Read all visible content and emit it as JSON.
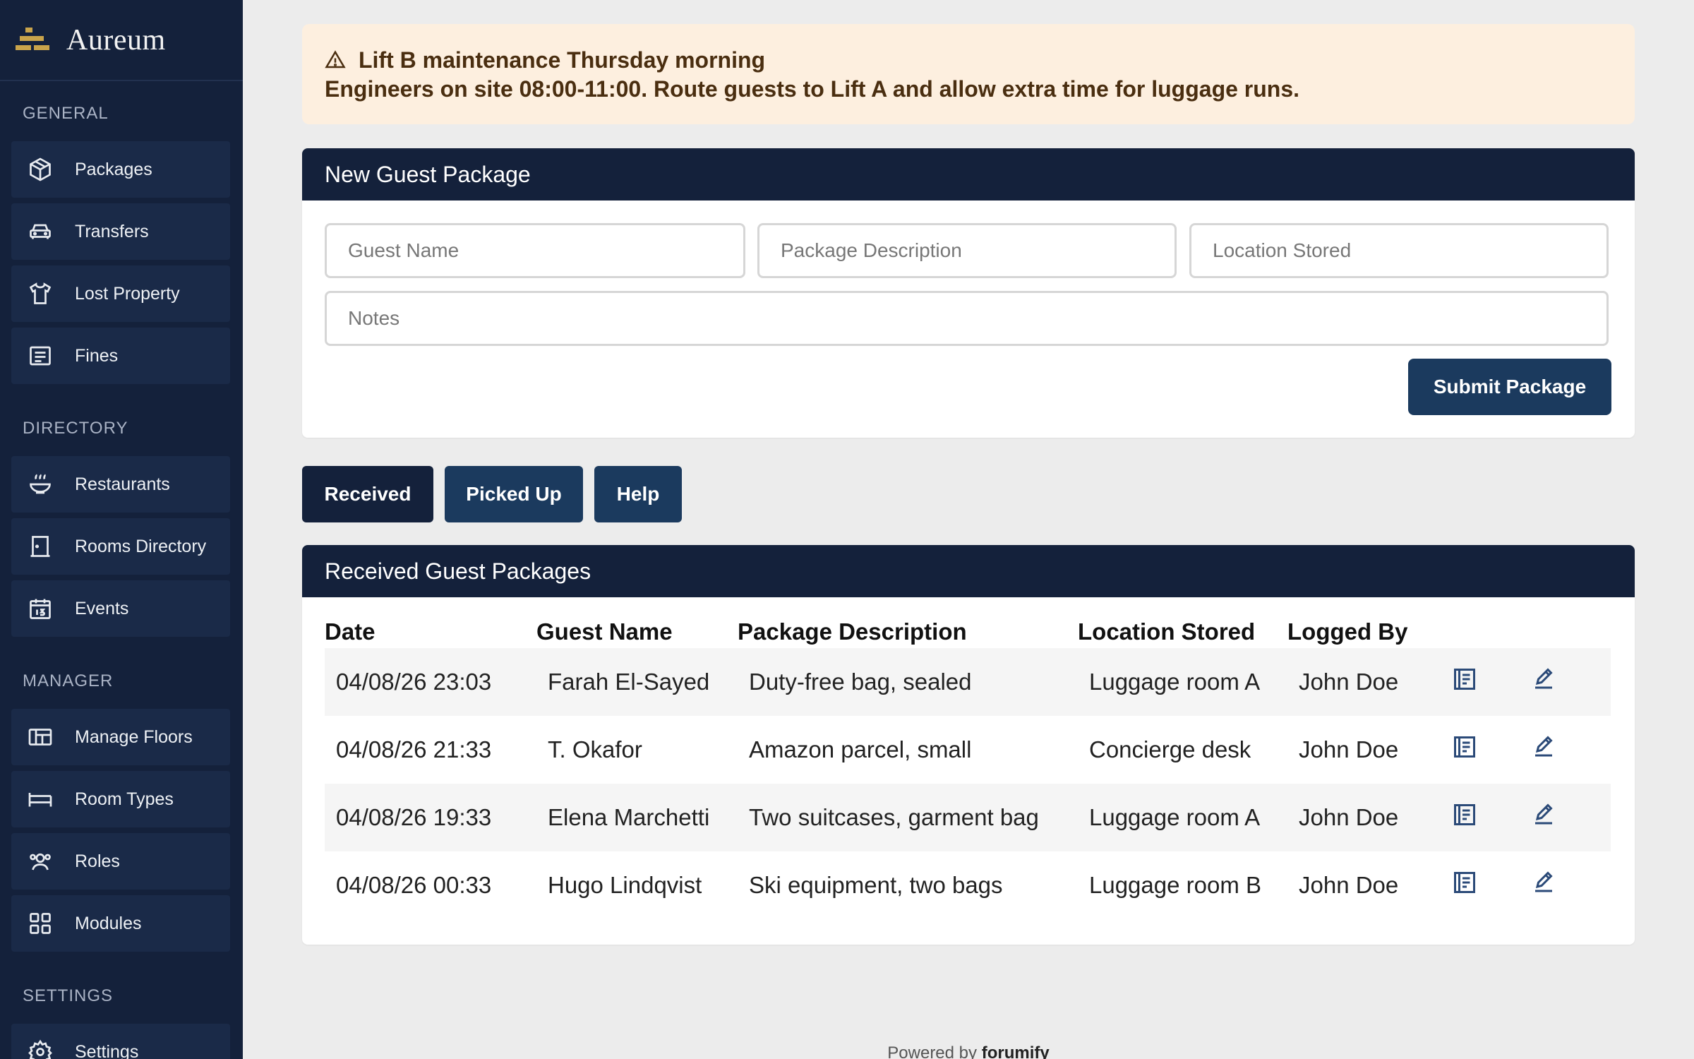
{
  "brand": {
    "name": "Aureum"
  },
  "sidebar": {
    "sections": [
      {
        "label": "GENERAL"
      },
      {
        "label": "DIRECTORY"
      },
      {
        "label": "MANAGER"
      },
      {
        "label": "SETTINGS"
      }
    ],
    "items": [
      {
        "label": "Packages",
        "icon": "package-icon"
      },
      {
        "label": "Transfers",
        "icon": "car-icon"
      },
      {
        "label": "Lost Property",
        "icon": "shirt-icon"
      },
      {
        "label": "Fines",
        "icon": "receipt-icon"
      },
      {
        "label": "Restaurants",
        "icon": "bowl-icon"
      },
      {
        "label": "Rooms Directory",
        "icon": "door-icon"
      },
      {
        "label": "Events",
        "icon": "calendar-icon"
      },
      {
        "label": "Manage Floors",
        "icon": "floor-plan-icon"
      },
      {
        "label": "Room Types",
        "icon": "bed-icon"
      },
      {
        "label": "Roles",
        "icon": "users-icon"
      },
      {
        "label": "Modules",
        "icon": "grid-icon"
      },
      {
        "label": "Settings",
        "icon": "gear-icon"
      }
    ]
  },
  "alert": {
    "title": "Lift B maintenance Thursday morning",
    "body": "Engineers on site 08:00-11:00. Route guests to Lift A and allow extra time for luggage runs."
  },
  "form": {
    "title": "New Guest Package",
    "guest_name_placeholder": "Guest Name",
    "package_description_placeholder": "Package Description",
    "location_stored_placeholder": "Location Stored",
    "notes_placeholder": "Notes",
    "submit_label": "Submit Package"
  },
  "tabs": [
    {
      "label": "Received"
    },
    {
      "label": "Picked Up"
    },
    {
      "label": "Help"
    }
  ],
  "table": {
    "title": "Received Guest Packages",
    "columns": [
      "Date",
      "Guest Name",
      "Package Description",
      "Location Stored",
      "Logged By"
    ],
    "rows": [
      {
        "date": "04/08/26 23:03",
        "guest": "Farah El-Sayed",
        "description": "Duty-free bag, sealed",
        "location": "Luggage room A",
        "logged_by": "John Doe"
      },
      {
        "date": "04/08/26 21:33",
        "guest": "T. Okafor",
        "description": "Amazon parcel, small",
        "location": "Concierge desk",
        "logged_by": "John Doe"
      },
      {
        "date": "04/08/26 19:33",
        "guest": "Elena Marchetti",
        "description": "Two suitcases, garment bag",
        "location": "Luggage room A",
        "logged_by": "John Doe"
      },
      {
        "date": "04/08/26 00:33",
        "guest": "Hugo Lindqvist",
        "description": "Ski equipment, two bags",
        "location": "Luggage room B",
        "logged_by": "John Doe"
      }
    ]
  },
  "footer": {
    "prefix": "Powered by",
    "brand": "forumify"
  },
  "colors": {
    "sidebar_bg": "#14213b",
    "accent": "#1b3a5e",
    "active_tab": "#14213b",
    "alert_bg": "#fdefdf",
    "logo_gold": "#c9a44b"
  }
}
